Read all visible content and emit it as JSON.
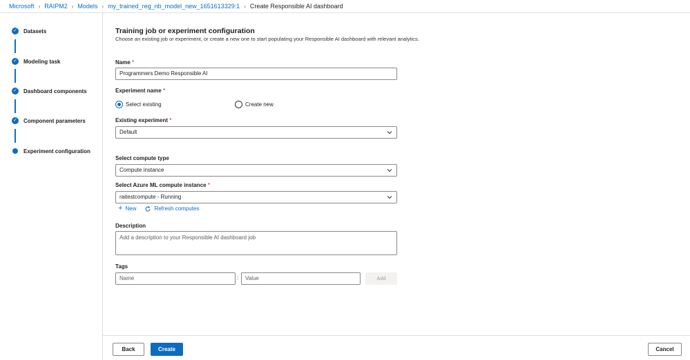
{
  "breadcrumb": [
    "Microsoft",
    "RAIPM2",
    "Models",
    "my_trained_reg_nb_model_new_1651613329:1",
    "Create Responsible AI dashboard"
  ],
  "steps": [
    {
      "label": "Datasets",
      "status": "complete"
    },
    {
      "label": "Modeling task",
      "status": "complete"
    },
    {
      "label": "Dashboard components",
      "status": "complete"
    },
    {
      "label": "Component parameters",
      "status": "complete"
    },
    {
      "label": "Experiment configuration",
      "status": "current"
    }
  ],
  "form": {
    "title": "Training job or experiment configuration",
    "subtitle": "Choose an existing job or experiment, or create a new one to start populating your Responsible AI dashboard with relevant analytics.",
    "name_label": "Name",
    "name_value": "Programmers Demo Responsible AI",
    "experiment_label": "Experiment name",
    "radio_existing": "Select existing",
    "radio_new": "Create new",
    "existing_label": "Existing experiment",
    "existing_value": "Default",
    "compute_type_label": "Select compute type",
    "compute_type_value": "Compute instance",
    "compute_instance_label": "Select Azure ML compute instance",
    "compute_instance_value": "raitestcompute - Running",
    "new_link": "New",
    "refresh_link": "Refresh computes",
    "description_label": "Description",
    "description_placeholder": "Add a description to your Responsible AI dashboard job",
    "tags_label": "Tags",
    "tag_name_placeholder": "Name",
    "tag_colon": ":",
    "tag_value_placeholder": "Value",
    "add_label": "Add",
    "required_mark": "*"
  },
  "footer": {
    "back": "Back",
    "create": "Create",
    "cancel": "Cancel"
  },
  "colors": {
    "accent": "#0f6cbd",
    "required": "#a4262c"
  }
}
